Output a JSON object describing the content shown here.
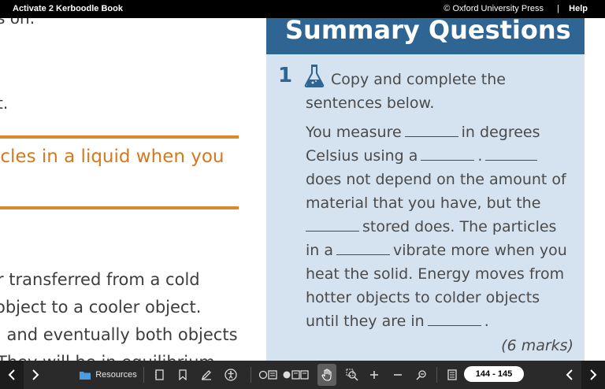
{
  "header": {
    "title": "Activate 2 Kerboodle Book",
    "copyright": "© Oxford University Press",
    "separator": "|",
    "help": "Help"
  },
  "left_page": {
    "top_fragment": "s on.",
    "t_fragment": "t.",
    "orange_heading": "icles in a liquid when you",
    "lines": [
      "r transferred from a cold",
      " object to a cooler object.",
      "l and eventually both objects",
      "They will be in equilibrium."
    ]
  },
  "summary": {
    "title": "Summary Questions",
    "question_number": "1",
    "intro_lines": [
      "Copy and complete the",
      "sentences below."
    ],
    "body": {
      "l1a": "You measure",
      "l1b": "in degrees",
      "l2a": "Celsius using a",
      "l2b": ".",
      "l3": "does not depend on the amount of",
      "l4": "material that you have, but the",
      "l5": "stored does. The particles",
      "l6a": "in a",
      "l6b": "vibrate more when you",
      "l7": "heat the solid. Energy moves from",
      "l8": "hotter objects to colder objects",
      "l9a": "until they are in",
      "l9b": "."
    },
    "marks": "(6 marks)"
  },
  "toolbar": {
    "resources_label": "Resources",
    "page_indicator": "144 - 145"
  },
  "colors": {
    "header_bg": "#000000",
    "summary_header": "#2e6592",
    "summary_panel": "#d5e3f0",
    "orange_accent": "#d9892e",
    "toolbar_bg": "#2a2a2a"
  }
}
